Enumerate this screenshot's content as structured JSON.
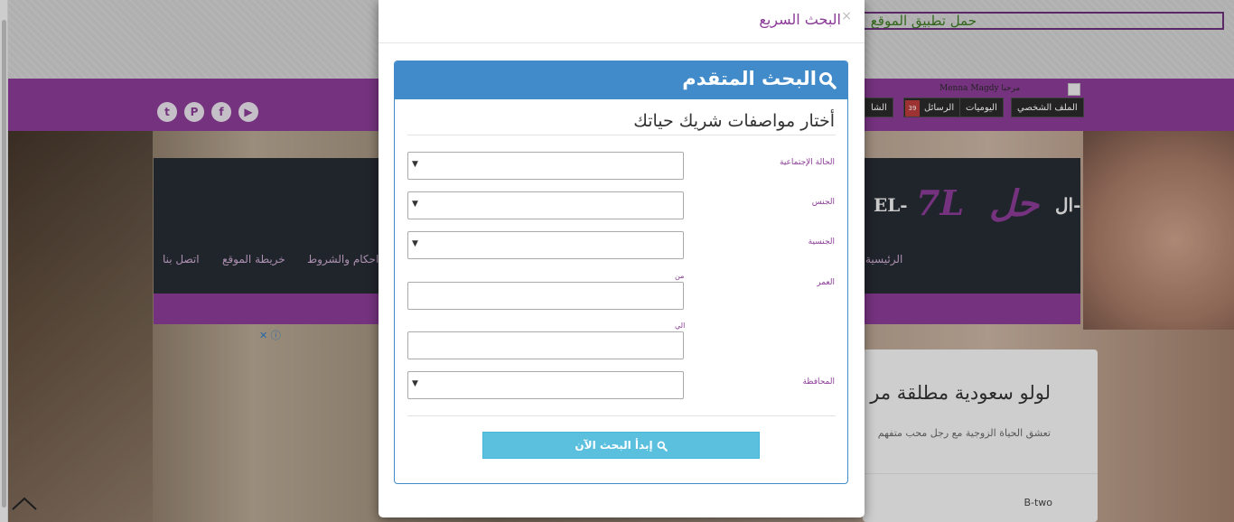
{
  "background": {
    "app_banner": "حمل تطبيق الموقع",
    "user": {
      "greeting": "مرحبا",
      "name": "Menna Magdy",
      "nav": [
        "الملف الشخصي",
        "اليوميات",
        "الرسائل",
        "الشا"
      ],
      "messages_badge": "39"
    },
    "social": [
      "youtube-icon",
      "facebook-icon",
      "pinterest-icon",
      "twitter-icon"
    ],
    "logo": {
      "prefix": "ال-",
      "main": "حل",
      "latin": "7L",
      "small": "EL-"
    },
    "mainnav": [
      "الرئيسية",
      "احكام والشروط",
      "خريطة الموقع",
      "اتصل بنا"
    ],
    "article": {
      "title": "لولو سعودية مطلقة مر",
      "snippet": "تعشق الحياة الزوجية مع رجل محب متفهم",
      "author": "B-two"
    }
  },
  "modal": {
    "title": "البحث السريع",
    "close": "×",
    "panel": {
      "title": "البحث المتقدم",
      "subtitle": "أختار مواصفات شريك حياتك",
      "fields": {
        "marital_status": {
          "label": "الحالة الإجتماعية",
          "value": ""
        },
        "gender": {
          "label": "الجنس",
          "value": ""
        },
        "nationality": {
          "label": "الجنسية",
          "value": ""
        },
        "age": {
          "label": "العمر",
          "from_label": "من",
          "to_label": "الي",
          "from": "",
          "to": ""
        },
        "governorate": {
          "label": "المحافظة",
          "value": ""
        }
      },
      "submit": "إبدأ البحث الآن"
    }
  },
  "colors": {
    "purple": "#8a3b96",
    "panel_blue": "#428bca",
    "button": "#5bc0de"
  }
}
